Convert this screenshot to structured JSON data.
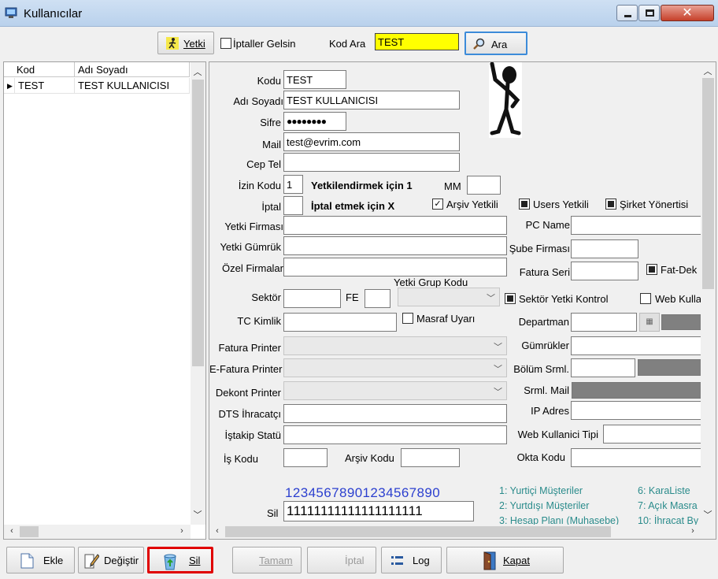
{
  "window": {
    "title": "Kullanıcılar",
    "close_glyph": "✕"
  },
  "toolbar": {
    "yetki_label": "Yetki",
    "iptaller_label": "İptaller Gelsin",
    "kod_ara_label": "Kod Ara",
    "kod_ara_value": "TEST",
    "ara_label": "Ara"
  },
  "grid": {
    "columns": [
      "Kod",
      "Adı Soyadı"
    ],
    "rows": [
      {
        "kod": "TEST",
        "adi": "TEST KULLANICISI"
      }
    ]
  },
  "form": {
    "kodu": {
      "label": "Kodu",
      "value": "TEST"
    },
    "adi_soyadi": {
      "label": "Adı Soyadı",
      "value": "TEST KULLANICISI"
    },
    "sifre": {
      "label": "Sifre",
      "value": "●●●●●●●●"
    },
    "mail": {
      "label": "Mail",
      "value": "test@evrim.com"
    },
    "cep_tel": {
      "label": "Cep Tel",
      "value": ""
    },
    "izin_kodu": {
      "label": "İzin Kodu",
      "value": "1",
      "hint": "Yetkilendirmek için 1"
    },
    "mm": {
      "label": "MM",
      "value": ""
    },
    "iptal": {
      "label": "İptal",
      "value": "",
      "hint": "İptal etmek için X"
    },
    "arsiv_yetkili": "Arşiv Yetkili",
    "users_yetkili": "Users Yetkili",
    "sirket_yonertisi": "Şirket Yönertisi",
    "yetki_firmasi": "Yetki Firması",
    "pc_name": "PC Name",
    "yetki_gumruk": "Yetki Gümrük",
    "sube_firmasi": "Şube Firması",
    "ozel_firmalar": "Özel Firmalar",
    "fatura_seri": "Fatura Seri",
    "fat_dek": "Fat-Dek",
    "yetki_grup_kodu": "Yetki Grup Kodu",
    "sektor": "Sektör",
    "fe": "FE",
    "sektor_yetki_kontrol": "Sektör Yetki Kontrol",
    "web_kullanici": "Web Kullanıcı",
    "tc_kimlik": "TC Kimlik",
    "masraf_uyari": "Masraf Uyarı",
    "departman": "Departman",
    "fatura_printer": "Fatura Printer",
    "gumrukler": "Gümrükler",
    "efatura_printer": "E-Fatura Printer",
    "bolum_srml": "Bölüm Srml.",
    "dekont_printer": "Dekont Printer",
    "srml_mail": "Srml. Mail",
    "dts_ihracatci": "DTS İhracatçı",
    "ip_adres": "IP Adres",
    "istakip_statu": "İştakip Statü",
    "web_kullanici_tipi": "Web Kullanici Tipi",
    "is_kodu": "İş Kodu",
    "arsiv_kodu": "Arşiv Kodu",
    "okta_kodu": "Okta Kodu",
    "sil_numbers": "12345678901234567890",
    "sil_label": "Sil",
    "sil_value": "11111111111111111111",
    "legend_left": [
      "1: Yurtiçi Müşteriler",
      "2: Yurtdışı Müşteriler",
      "3: Hesap Planı (Muhasebe)"
    ],
    "legend_right": [
      "6: KaraListe",
      "7: Açık Masra",
      "10: İhracat By"
    ]
  },
  "buttons": {
    "ekle": "Ekle",
    "degistir": "Değiştir",
    "sil": "Sil",
    "tamam": "Tamam",
    "iptal": "İptal",
    "log": "Log",
    "kapat": "Kapat"
  },
  "colors": {
    "search_highlight": "#ffff00",
    "sil_outline": "#e00000",
    "legend_text": "#2a8b8b",
    "numbers_text": "#2b3fcf"
  }
}
